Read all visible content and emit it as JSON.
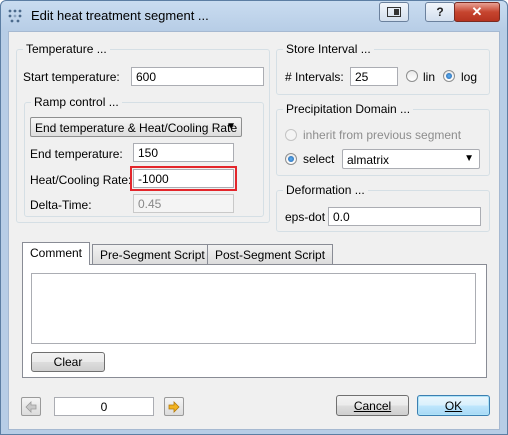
{
  "window": {
    "title": "Edit heat treatment segment ..."
  },
  "temperature": {
    "title": "Temperature ...",
    "start_label": "Start temperature:",
    "start_value": "600",
    "ramp": {
      "title": "Ramp control ...",
      "mode_selected": "End temperature & Heat/Cooling Rate",
      "end_label": "End temperature:",
      "end_value": "150",
      "rate_label": "Heat/Cooling Rate:",
      "rate_value": "-1000",
      "delta_label": "Delta-Time:",
      "delta_value": "0.45"
    }
  },
  "store_interval": {
    "title": "Store Interval ...",
    "intervals_label": "# Intervals:",
    "intervals_value": "25",
    "lin_label": "lin",
    "log_label": "log",
    "selected": "log"
  },
  "precipitation": {
    "title": "Precipitation Domain ...",
    "inherit_label": "inherit from previous segment",
    "select_label": "select",
    "domain_selected": "almatrix"
  },
  "deformation": {
    "title": "Deformation ...",
    "eps_label": "eps-dot",
    "eps_value": "0.0"
  },
  "tabs": [
    {
      "label": "Comment",
      "active": true
    },
    {
      "label": "Pre-Segment Script",
      "active": false
    },
    {
      "label": "Post-Segment Script",
      "active": false
    }
  ],
  "comment": {
    "text": "",
    "clear_label": "Clear"
  },
  "footer": {
    "segment_index": "0",
    "cancel_label": "Cancel",
    "ok_label": "OK"
  },
  "colors": {
    "highlight": "#e3262b",
    "titlebar": "#b7cde6",
    "close": "#c6452f"
  },
  "icons": [
    "app-icon",
    "restore-icon",
    "help-icon",
    "close-icon",
    "arrow-left-icon",
    "arrow-right-icon",
    "chevron-down-icon"
  ]
}
